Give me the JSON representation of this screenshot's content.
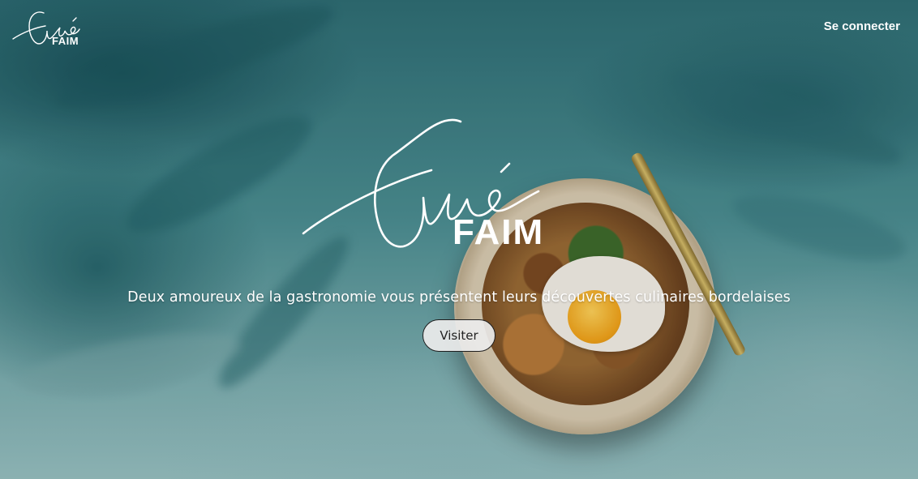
{
  "header": {
    "logo": {
      "script_text": "Gavé",
      "word": "FAIM"
    },
    "login_label": "Se connecter"
  },
  "hero": {
    "logo": {
      "script_text": "Gavé",
      "word": "FAIM"
    },
    "tagline": "Deux amoureux de la gastronomie vous présentent leurs découvertes culinaires bordelaises",
    "visit_label": "Visiter"
  },
  "background": {
    "image": "painted-teal-background-with-food-plate",
    "accent_color": "#3f7f84"
  }
}
